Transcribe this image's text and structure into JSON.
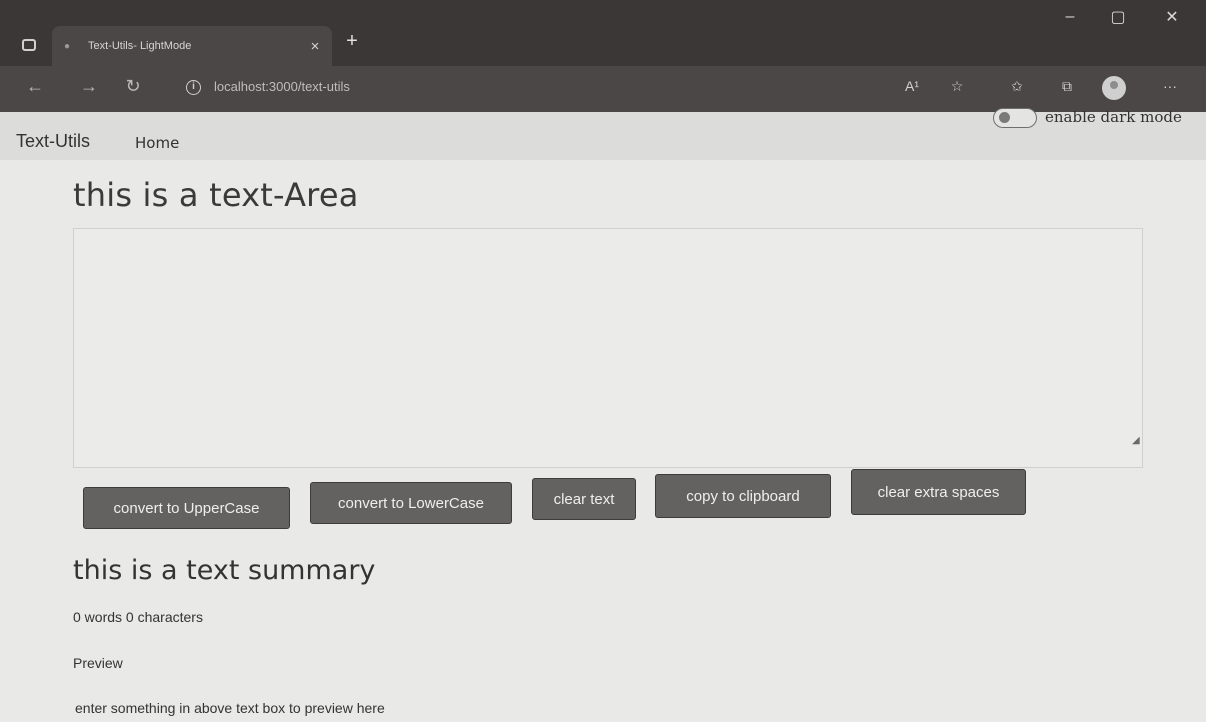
{
  "browser": {
    "tab_title": "Text-Utils- LightMode",
    "tab_close": "×",
    "new_tab": "+",
    "url": "localhost:3000/text-utils",
    "window_controls": {
      "minimize": "–",
      "maximize": "▢",
      "close": "✕"
    },
    "nav_icons": {
      "back": "←",
      "forward": "→",
      "refresh": "↻"
    },
    "toolbar_icons": {
      "read_aloud": "A¹",
      "add_favorite": "☆",
      "favorites": "✩",
      "collections": "⧉",
      "more": "···"
    }
  },
  "navbar": {
    "brand": "Text-Utils",
    "home_link": "Home",
    "dark_mode_label": "enable dark mode"
  },
  "textarea": {
    "heading": "this is a text-Area",
    "value": "",
    "resize_glyph": "◢"
  },
  "buttons": {
    "upper": "convert to UpperCase",
    "lower": "convert to LowerCase",
    "clear": "clear text",
    "copy": "copy to clipboard",
    "extra_spaces": "clear extra spaces"
  },
  "summary": {
    "heading": "this is a text summary",
    "stats": "0 words 0 characters",
    "preview_heading": "Preview",
    "preview_text": "enter something in above text box to preview here"
  },
  "colors": {
    "chrome_dark": "#3a3736",
    "navbar_bg": "#dcdcda",
    "page_bg": "#e9e9e7",
    "button_bg": "#646261"
  }
}
